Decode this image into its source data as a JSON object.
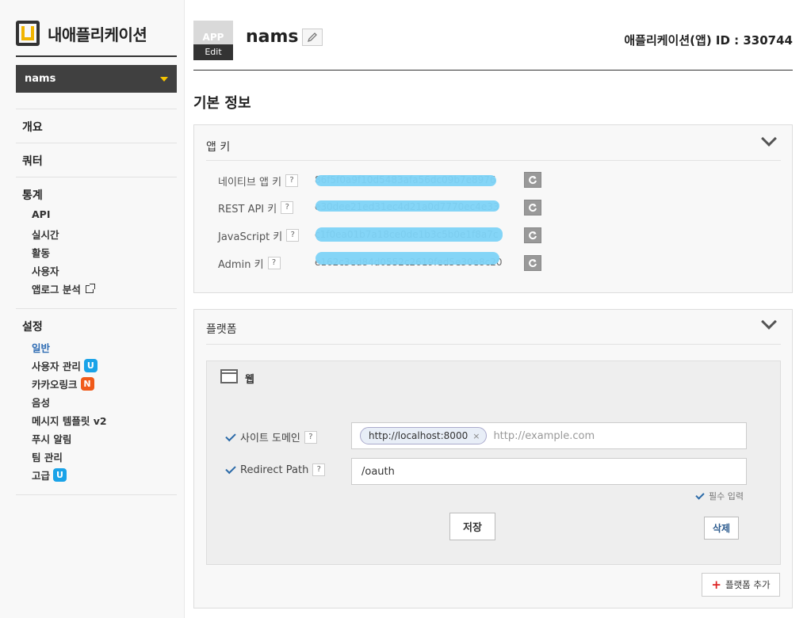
{
  "brand": {
    "title": "내애플리케이션"
  },
  "app_selector": {
    "value": "nams"
  },
  "sidebar": {
    "overview": "개요",
    "quota": "쿼터",
    "stats": {
      "label": "통계",
      "items": [
        "API",
        "실시간",
        "활동",
        "사용자",
        "앱로그 분석"
      ]
    },
    "settings": {
      "label": "설정",
      "items": [
        {
          "label": "일반",
          "badge": ""
        },
        {
          "label": "사용자 관리",
          "badge": "U"
        },
        {
          "label": "카카오링크",
          "badge": "N"
        },
        {
          "label": "음성",
          "badge": ""
        },
        {
          "label": "메시지 템플릿 v2",
          "badge": ""
        },
        {
          "label": "푸시 알림",
          "badge": ""
        },
        {
          "label": "팀 관리",
          "badge": ""
        },
        {
          "label": "고급",
          "badge": "U"
        }
      ]
    }
  },
  "header": {
    "thumb_text": "APP",
    "edit_label": "Edit",
    "app_name": "nams",
    "app_id": "애플리케이션(앱) ID : 330744"
  },
  "basic_info": {
    "title": "기본 정보"
  },
  "app_keys": {
    "title": "앱 키",
    "help": "?",
    "rows": [
      {
        "label": "네이티브 앱 키",
        "value": "86f5f0a9f10d5483afa56dc09b7e8976"
      },
      {
        "label": "REST API 키",
        "value": "e30dee21ed31ec4d21a0d7770ec4e33"
      },
      {
        "label": "JavaScript 키",
        "value": "c1f0ea01b7a18ce0de1b3c5b0e1f8a7c"
      },
      {
        "label": "Admin 키",
        "value": "e162c3ed84d0552c2619fed5e30e8c20"
      }
    ]
  },
  "platform": {
    "title": "플랫폼",
    "web": {
      "title": "웹",
      "site_domain_label": "사이트 도메인",
      "site_domain_chip": "http://localhost:8000",
      "site_domain_placeholder": "http://example.com",
      "redirect_label": "Redirect Path",
      "redirect_value": "/oauth",
      "required_note": "필수 입력",
      "save_label": "저장",
      "delete_label": "삭제"
    },
    "add_label": "플랫폼 추가"
  }
}
